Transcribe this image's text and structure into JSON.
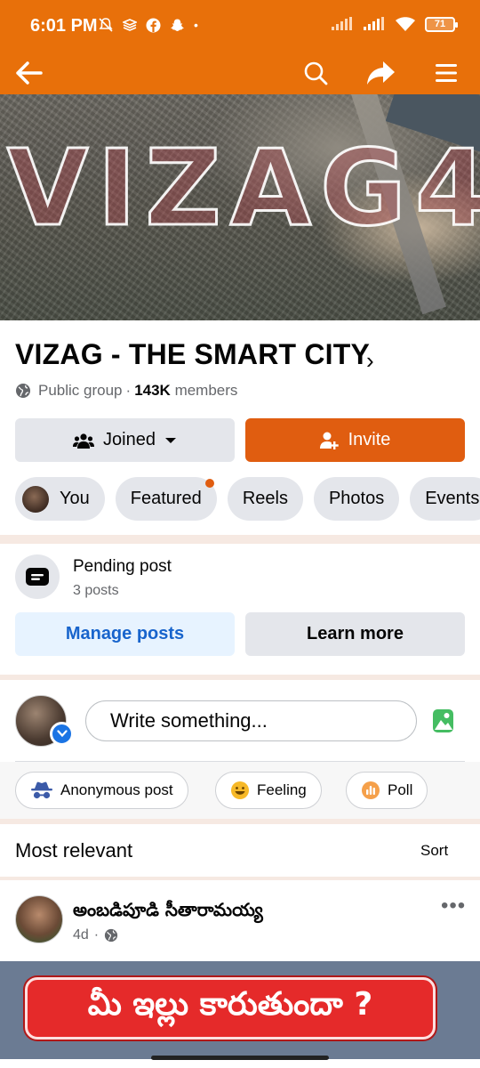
{
  "status_bar": {
    "time": "6:01 PM",
    "battery": "71"
  },
  "app_bar": {
    "icons": [
      "back-arrow-icon",
      "search-icon",
      "share-icon",
      "menu-icon"
    ],
    "color": "#e8700a"
  },
  "cover": {
    "text": "VIZAG4"
  },
  "group": {
    "name": "VIZAG - THE SMART CITY",
    "privacy": "Public group",
    "separator": "·",
    "member_count": "143K",
    "members_label": "members",
    "joined_label": "Joined",
    "invite_label": "Invite"
  },
  "tabs": [
    {
      "label": "You"
    },
    {
      "label": "Featured"
    },
    {
      "label": "Reels"
    },
    {
      "label": "Photos"
    },
    {
      "label": "Events"
    }
  ],
  "pending": {
    "title": "Pending post",
    "count": "3 posts",
    "manage_label": "Manage posts",
    "learn_label": "Learn more"
  },
  "composer": {
    "placeholder": "Write something..."
  },
  "quick_actions": [
    {
      "label": "Anonymous post",
      "icon": "incognito-icon"
    },
    {
      "label": "Feeling",
      "icon": "smile-icon"
    },
    {
      "label": "Poll",
      "icon": "poll-icon"
    }
  ],
  "feed": {
    "sort_title": "Most relevant",
    "sort_label": "Sort"
  },
  "post": {
    "author": "అంబడిపూడి సీతారామయ్య",
    "time": "4d",
    "separator": "·",
    "image_text": "మీ ఇల్లు కారుతుందా ?"
  },
  "colors": {
    "accent": "#e8700a",
    "invite": "#e05d10",
    "link_blue": "#1864cc"
  }
}
